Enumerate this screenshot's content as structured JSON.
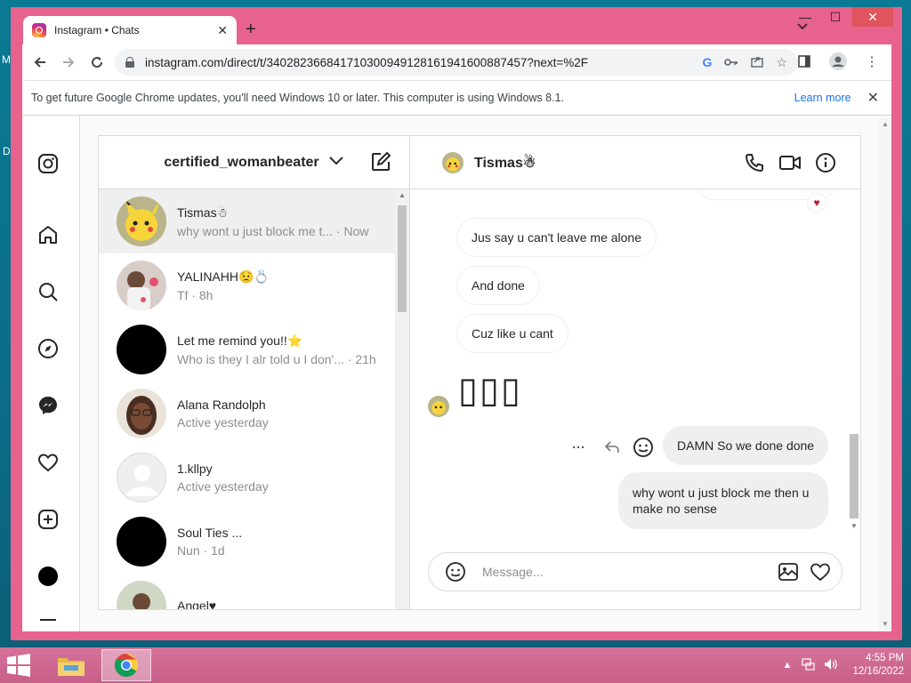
{
  "desktop": {
    "letter_m": "M",
    "letter_d": "D"
  },
  "browser": {
    "tab_title": "Instagram • Chats",
    "tab_close": "✕",
    "new_tab": "+",
    "url": "instagram.com/direct/t/340282366841710300949128161941600887457?next=%2F",
    "info_text": "To get future Google Chrome updates, you'll need Windows 10 or later. This computer is using Windows 8.1.",
    "learn_more": "Learn more",
    "info_close": "✕",
    "window_controls": {
      "minimize": "—",
      "maximize": "☐",
      "close": "✕"
    },
    "accent_color": "#e8628e"
  },
  "dm": {
    "account": "certified_womanbeater",
    "threads": [
      {
        "name": "Tismas☃",
        "preview": "why wont u just block me t...",
        "time": "· Now",
        "active": true,
        "avatar": "pikachu"
      },
      {
        "name": "YALINAHH😟💍",
        "preview": "Tf",
        "time": "· 8h",
        "avatar": "photo-pink"
      },
      {
        "name": "Let me remind you!!⭐",
        "preview": "Who is they I alr told u I don'...",
        "time": "· 21h",
        "avatar": "black"
      },
      {
        "name": "Alana Randolph",
        "preview": "Active yesterday",
        "time": "",
        "avatar": "photo-face"
      },
      {
        "name": "1.kllpy",
        "preview": "Active yesterday",
        "time": "",
        "avatar": "default"
      },
      {
        "name": "Soul Ties ...",
        "preview": "Nun",
        "time": "· 1d",
        "avatar": "black"
      },
      {
        "name": "Angel♥",
        "preview": "",
        "time": "",
        "avatar": "photo-angel"
      }
    ],
    "chat": {
      "name": "Tismas☃",
      "messages": [
        {
          "text": "Jus say u can't leave me alone",
          "dir": "in"
        },
        {
          "text": "And done",
          "dir": "in"
        },
        {
          "text": "Cuz like u cant",
          "dir": "in"
        },
        {
          "text": "▯▯▯",
          "dir": "in-big"
        },
        {
          "text": "DAMN So we done done",
          "dir": "out"
        },
        {
          "text": "why wont u just block me then u make no sense",
          "dir": "out"
        }
      ],
      "heart_reaction": "♥",
      "more_dots": "···",
      "message_placeholder": "Message..."
    }
  },
  "taskbar": {
    "time": "4:55 PM",
    "date": "12/16/2022"
  }
}
